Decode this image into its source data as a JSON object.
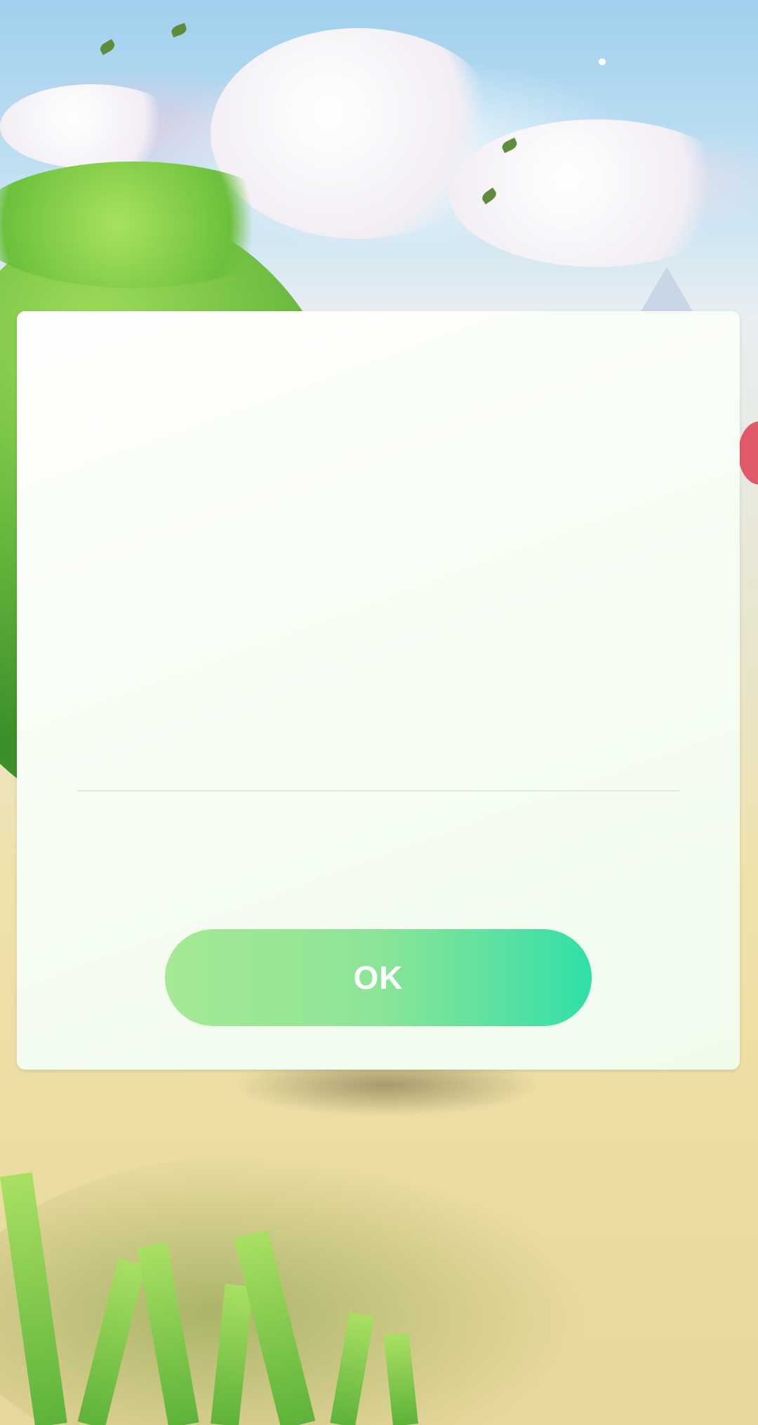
{
  "dialog": {
    "ok_label": "OK"
  },
  "colors": {
    "button_gradient_start": "#a6e895",
    "button_gradient_end": "#2ee0a8",
    "dialog_background": "#f6fdf2",
    "button_text": "#ffffff"
  }
}
